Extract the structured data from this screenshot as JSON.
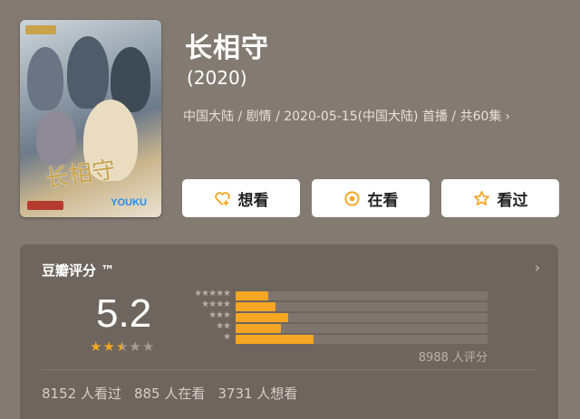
{
  "title": "长相守",
  "year": "(2020)",
  "meta": "中国大陆 / 剧情 / 2020-05-15(中国大陆) 首播 / 共60集",
  "meta_chevron": "›",
  "poster": {
    "calligraphy": "长相守",
    "brand": "YOUKU"
  },
  "actions": [
    {
      "label": "想看",
      "icon": "heart-plus-icon"
    },
    {
      "label": "在看",
      "icon": "target-icon"
    },
    {
      "label": "看过",
      "icon": "star-outline-icon"
    }
  ],
  "rating": {
    "source_label": "豆瓣评分 ™",
    "chevron": "›",
    "score": "5.2",
    "stars_value": 2.5,
    "stars_max": 5,
    "star_color": "#f5a623",
    "distribution": [
      {
        "stars": "★★★★★",
        "fraction": 0.13
      },
      {
        "stars": "★★★★",
        "fraction": 0.16
      },
      {
        "stars": "★★★",
        "fraction": 0.21
      },
      {
        "stars": "★★",
        "fraction": 0.18
      },
      {
        "stars": "★",
        "fraction": 0.31
      }
    ],
    "count": "8988 人评分",
    "stats": {
      "watched": "8152 人看过",
      "watching": "885 人在看",
      "want": "3731 人想看"
    }
  }
}
